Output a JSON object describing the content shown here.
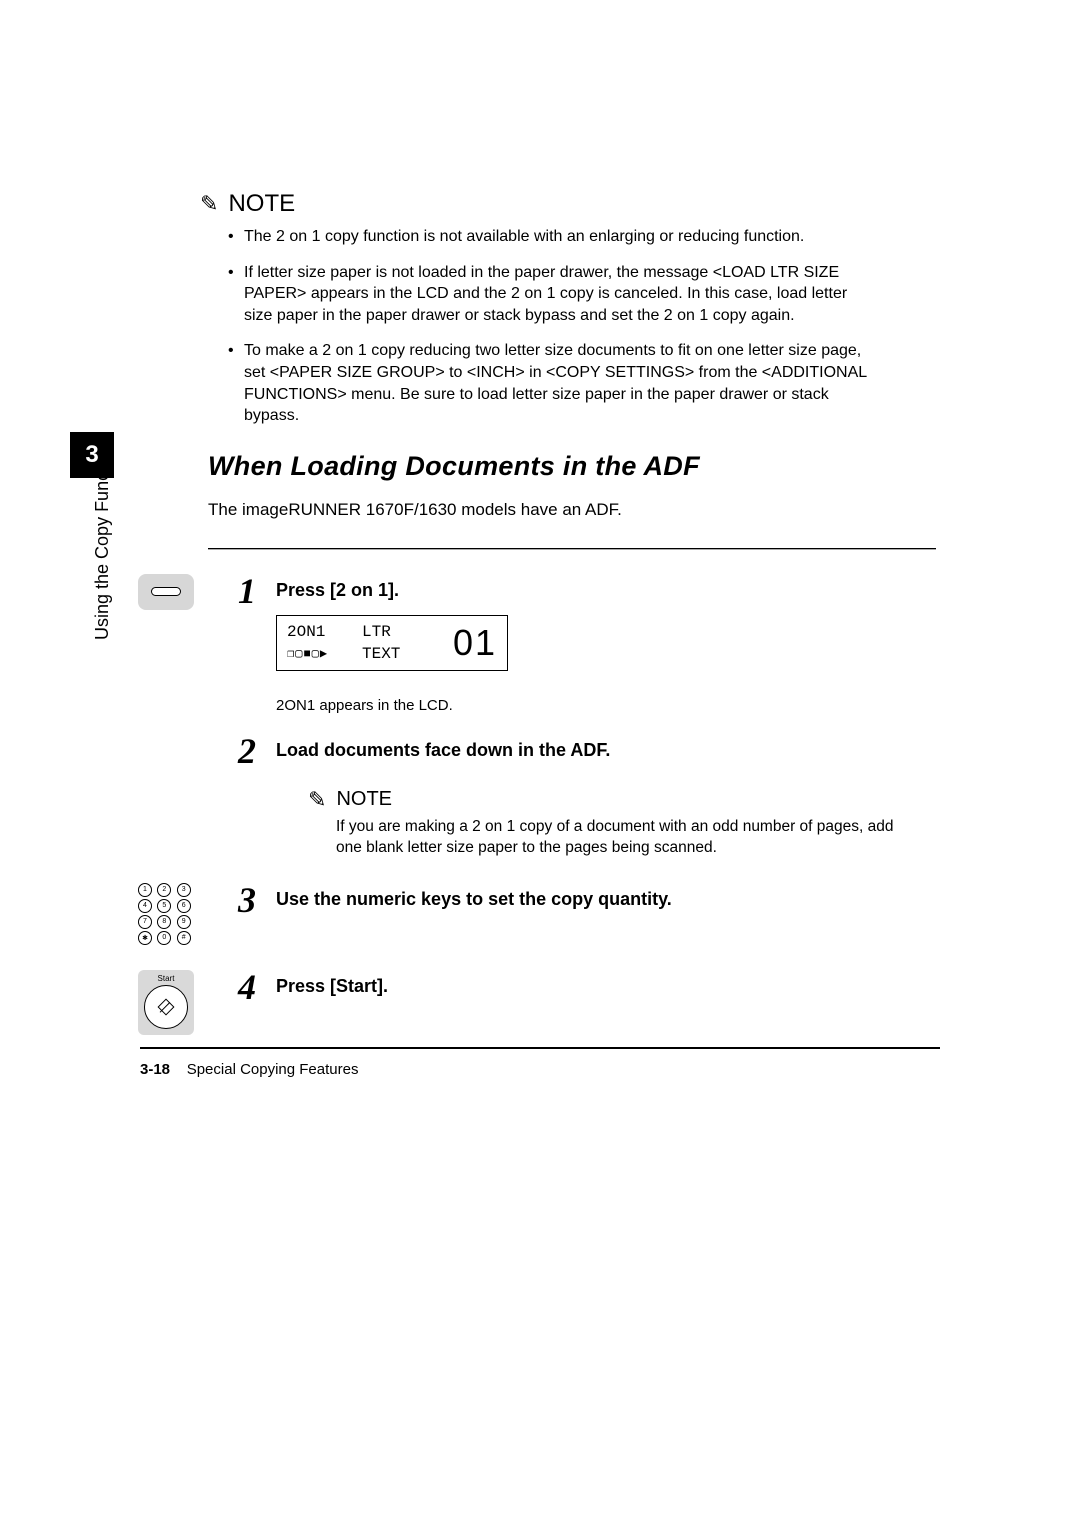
{
  "chapterTab": "3",
  "sideLabel": "Using the Copy Functions",
  "note1": {
    "heading": "NOTE",
    "bullets": [
      "The 2 on 1 copy function is not available with an enlarging or reducing function.",
      "If letter size paper is not loaded in the paper drawer, the message <LOAD LTR SIZE PAPER> appears in the LCD and the 2 on 1 copy is canceled. In this case, load letter size paper in the paper drawer or stack bypass and set the 2 on 1 copy again.",
      "To make a 2 on 1 copy reducing two letter size documents to fit on one letter size page, set <PAPER SIZE GROUP> to <INCH> in <COPY SETTINGS> from the <ADDITIONAL FUNCTIONS> menu. Be sure to load letter size paper in the paper drawer or stack bypass."
    ]
  },
  "sectionHeading": "When Loading Documents in the ADF",
  "intro": "The imageRUNNER 1670F/1630 models have an ADF.",
  "step1": {
    "num": "1",
    "text": "Press [2 on 1].",
    "lcd": {
      "l1a": "2ON1",
      "l1b": "LTR",
      "l2a": "❐▢■▢▶",
      "l2b": "TEXT",
      "qty": "01"
    },
    "caption": "2ON1 appears in the LCD."
  },
  "step2": {
    "num": "2",
    "text": "Load documents face down in the ADF."
  },
  "note2": {
    "heading": "NOTE",
    "body": "If you are making a 2 on 1 copy of a document with an odd number of pages, add one blank letter size paper to the pages being scanned."
  },
  "step3": {
    "num": "3",
    "text": "Use the numeric keys to set the copy quantity."
  },
  "step4": {
    "num": "4",
    "text": "Press [Start].",
    "startLabel": "Start"
  },
  "keypad": [
    "1",
    "2",
    "3",
    "4",
    "5",
    "6",
    "7",
    "8",
    "9",
    "✱",
    "0",
    "#"
  ],
  "footer": {
    "pageNum": "3-18",
    "title": "Special Copying Features"
  }
}
